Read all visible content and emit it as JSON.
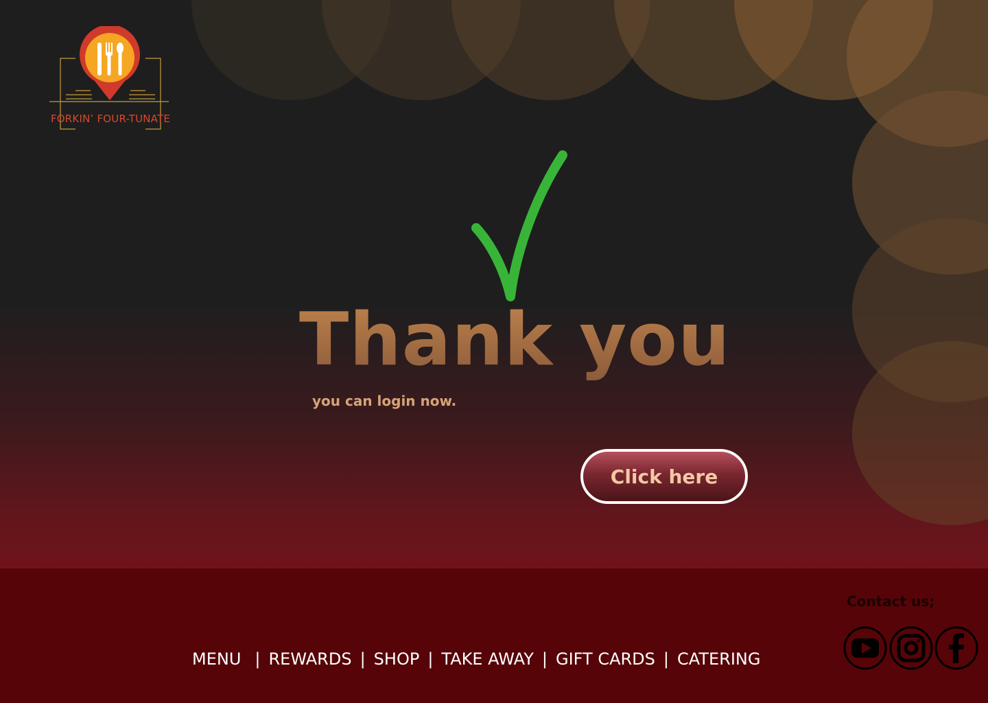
{
  "brand": {
    "name": "FORKIN’ FOUR-TUNATE",
    "logo_icon": "fork-knife-spoon-pin-icon",
    "colors": {
      "orange": "#f5a623",
      "red": "#d03a2a",
      "gold": "#c89a3c"
    }
  },
  "main": {
    "title": "Thank you!",
    "subtitle": "you can login now.",
    "check_icon": "green-checkmark-icon",
    "check_color": "#38b538",
    "cta_label": "Click here"
  },
  "footer": {
    "nav": [
      {
        "label": "MENU"
      },
      {
        "label": "REWARDS"
      },
      {
        "label": "SHOP"
      },
      {
        "label": "TAKE AWAY"
      },
      {
        "label": "GIFT CARDS"
      },
      {
        "label": "CATERING"
      }
    ],
    "separator": "|",
    "contact_label": "Contact us;",
    "social": [
      {
        "name": "youtube-icon"
      },
      {
        "name": "instagram-icon"
      },
      {
        "name": "facebook-icon"
      }
    ],
    "background": "#560408"
  }
}
